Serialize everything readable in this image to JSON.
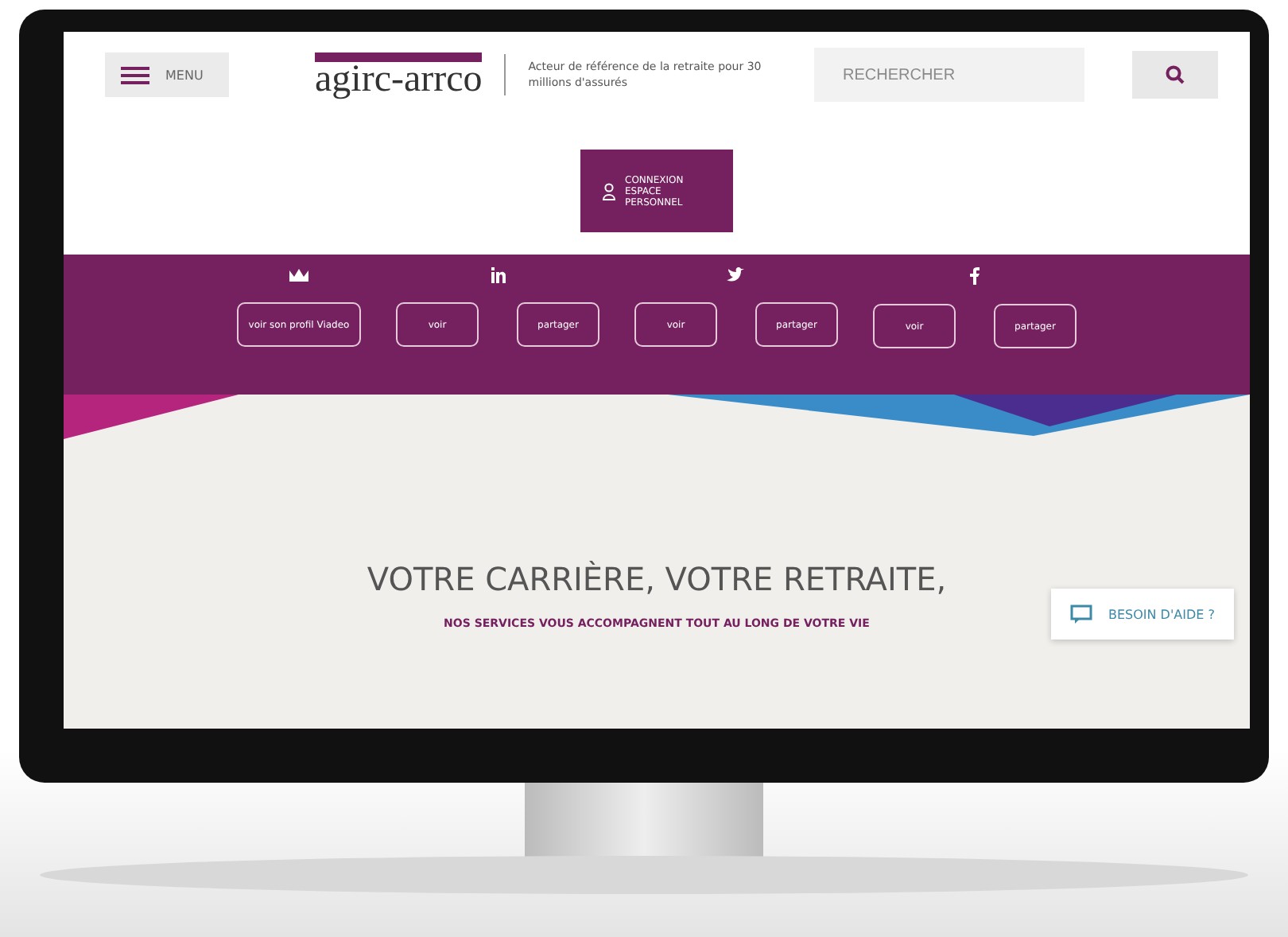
{
  "header": {
    "menu_label": "MENU",
    "logo": "agirc-arrco",
    "tagline": "Acteur de référence de la retraite pour 30 millions d'assurés",
    "search": {
      "placeholder": "RECHERCHER"
    }
  },
  "account_button": {
    "lines": [
      "CONNEXION",
      "ESPACE",
      "PERSONNEL"
    ]
  },
  "social": [
    {
      "kind": "crown",
      "buttons": [
        "voir son profil Viadeo"
      ]
    },
    {
      "kind": "linkedin",
      "buttons": [
        "voir",
        "partager"
      ]
    },
    {
      "kind": "twitter",
      "buttons": [
        "voir",
        "partager"
      ]
    },
    {
      "kind": "facebook",
      "buttons": [
        "voir",
        "partager"
      ]
    }
  ],
  "hero": {
    "title": "VOTRE CARRIÈRE, VOTRE RETRAITE,",
    "subtitle": "NOS SERVICES VOUS ACCOMPAGNENT TOUT AU LONG DE VOTRE VIE"
  },
  "help_button": {
    "label": "BESOIN D'AIDE ?"
  }
}
